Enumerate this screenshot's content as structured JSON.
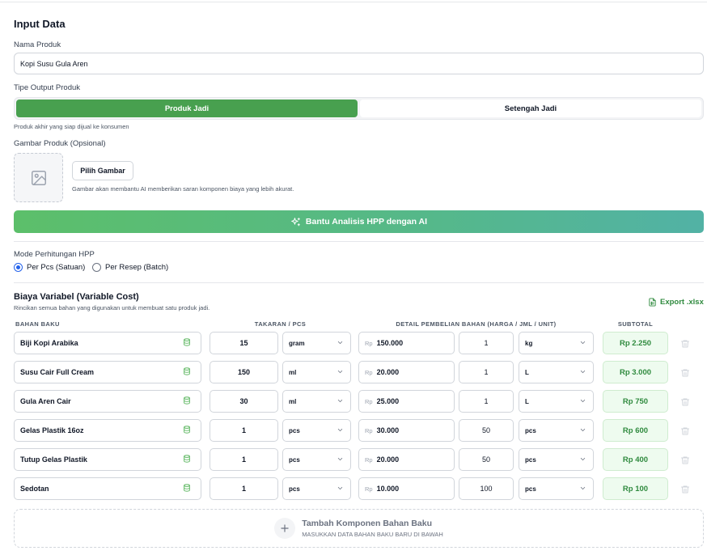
{
  "section_title": "Input Data",
  "product_name": {
    "label": "Nama Produk",
    "value": "Kopi Susu Gula Aren"
  },
  "output_type": {
    "label": "Tipe Output Produk",
    "options": [
      "Produk Jadi",
      "Setengah Jadi"
    ],
    "selected": "Produk Jadi",
    "helper": "Produk akhir yang siap dijual ke konsumen"
  },
  "image": {
    "label": "Gambar Produk (Opsional)",
    "button": "Pilih Gambar",
    "helper": "Gambar akan membantu AI memberikan saran komponen biaya yang lebih akurat."
  },
  "ai_button": "Bantu Analisis HPP dengan AI",
  "mode": {
    "label": "Mode Perhitungan HPP",
    "options": [
      "Per Pcs (Satuan)",
      "Per Resep (Batch)"
    ],
    "selected": "Per Pcs (Satuan)"
  },
  "variable_cost": {
    "title": "Biaya Variabel (Variable Cost)",
    "subtitle": "Rincikan semua bahan yang digunakan untuk membuat satu produk jadi.",
    "export_label": "Export .xlsx",
    "headers": [
      "BAHAN BAKU",
      "TAKARAN / PCS",
      "DETAIL PEMBELIAN BAHAN (HARGA / JML / UNIT)",
      "SUBTOTAL"
    ],
    "currency": "Rp",
    "rows": [
      {
        "name": "Biji Kopi Arabika",
        "qty": "15",
        "qty_unit": "gram",
        "price": "150.000",
        "jml": "1",
        "unit": "kg",
        "subtotal": "Rp 2.250"
      },
      {
        "name": "Susu Cair Full Cream",
        "qty": "150",
        "qty_unit": "ml",
        "price": "20.000",
        "jml": "1",
        "unit": "L",
        "subtotal": "Rp 3.000"
      },
      {
        "name": "Gula Aren Cair",
        "qty": "30",
        "qty_unit": "ml",
        "price": "25.000",
        "jml": "1",
        "unit": "L",
        "subtotal": "Rp 750"
      },
      {
        "name": "Gelas Plastik 16oz",
        "qty": "1",
        "qty_unit": "pcs",
        "price": "30.000",
        "jml": "50",
        "unit": "pcs",
        "subtotal": "Rp 600"
      },
      {
        "name": "Tutup Gelas Plastik",
        "qty": "1",
        "qty_unit": "pcs",
        "price": "20.000",
        "jml": "50",
        "unit": "pcs",
        "subtotal": "Rp 400"
      },
      {
        "name": "Sedotan",
        "qty": "1",
        "qty_unit": "pcs",
        "price": "10.000",
        "jml": "100",
        "unit": "pcs",
        "subtotal": "Rp 100"
      }
    ],
    "add_title": "Tambah Komponen Bahan Baku",
    "add_subtitle": "MASUKKAN DATA BAHAN BAKU BARU DI BAWAH"
  },
  "colors": {
    "primary_green": "#48a04f",
    "subtotal_text": "#2f8a3e",
    "radio_blue": "#2563eb"
  }
}
